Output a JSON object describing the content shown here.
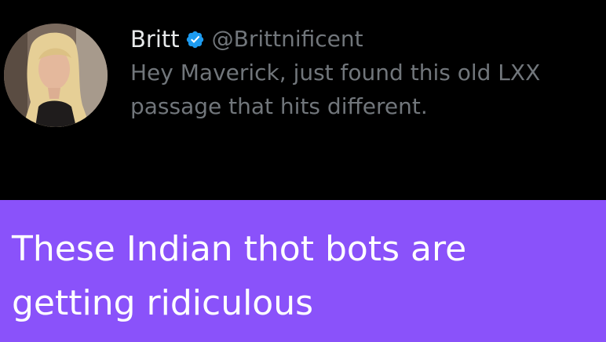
{
  "tweet": {
    "display_name": "Britt",
    "handle": "@Brittnificent",
    "verified_icon": "verified-badge-icon",
    "text_lines": [
      "Hey Maverick, just found this old LXX",
      "passage that hits different."
    ]
  },
  "caption": {
    "lines": [
      "These Indian thot bots are",
      "getting ridiculous"
    ]
  },
  "colors": {
    "tweet_background": "#000000",
    "name": "#e7e9ea",
    "secondary_text": "#71767b",
    "verified_blue": "#1d9bf0",
    "caption_background": "#8a52fa",
    "caption_text": "#ffffff"
  }
}
